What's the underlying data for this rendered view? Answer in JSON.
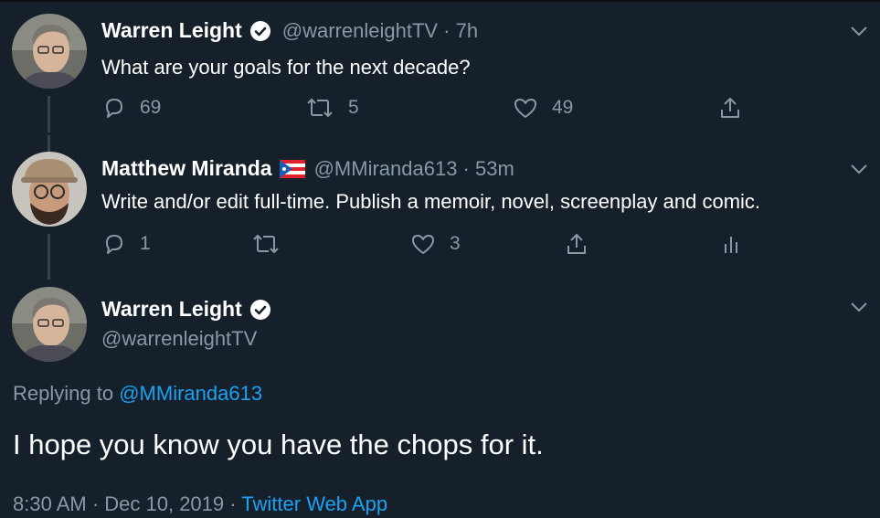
{
  "tweets": [
    {
      "name": "Warren Leight",
      "handle_time": "@warrenleightTV · 7h",
      "text": "What are your goals for the next decade?",
      "replies": "69",
      "retweets": "5",
      "likes": "49",
      "avatar": "warren-avatar",
      "verified": true
    },
    {
      "name": "Matthew Miranda",
      "flag": "puerto-rico-flag",
      "handle_time": "@MMiranda613 · 53m",
      "text": "Write and/or edit full-time. Publish a memoir, novel, screenplay and comic.",
      "replies": "1",
      "retweets": "",
      "likes": "3",
      "avatar": "matthew-avatar"
    }
  ],
  "focus": {
    "name": "Warren Leight",
    "handle": "@warrenleightTV",
    "replying_prefix": "Replying to",
    "replying_to": "@MMiranda613",
    "text": "I hope you know you have the chops for it.",
    "timestamp": "8:30 AM · Dec 10, 2019 · ",
    "source": "Twitter Web App"
  },
  "colors": {
    "background": "#15202b",
    "muted": "#8899a6",
    "link": "#1da1f2",
    "thread_line": "#38444d"
  }
}
